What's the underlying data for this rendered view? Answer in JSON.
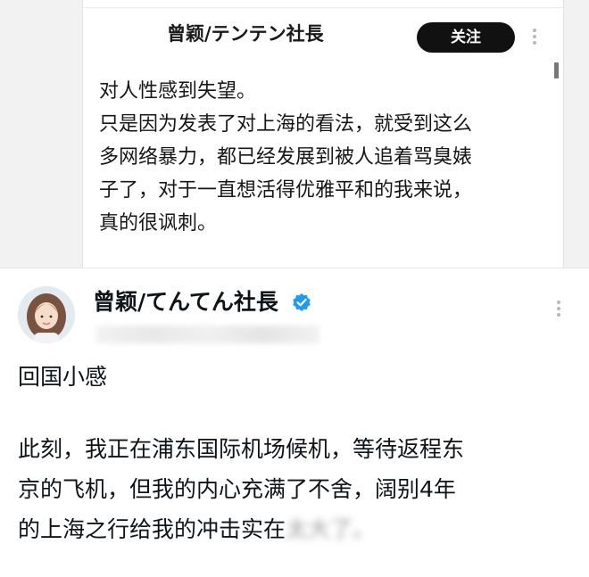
{
  "top_post": {
    "author_name": "曾颖/テンテン社長",
    "follow_label": "关注",
    "body_lines": [
      "对人性感到失望。",
      "只是因为发表了对上海的看法，就受到这么",
      "多网络暴力，都已经发展到被人追着骂臭婊",
      "子了，对于一直想活得优雅平和的我来说，",
      "真的很讽刺。"
    ]
  },
  "bottom_post": {
    "author_name": "曾颖/てんてん社長",
    "verified_color": "#1d9bf0",
    "title": "回国小感",
    "body_lines": [
      "此刻，我正在浦东国际机场候机，等待返程东",
      "京的飞机，但我的内心充满了不舍，阔别4年"
    ],
    "last_line_visible": "的上海之行给我的冲击实在",
    "last_line_blurred": "太大了。"
  }
}
